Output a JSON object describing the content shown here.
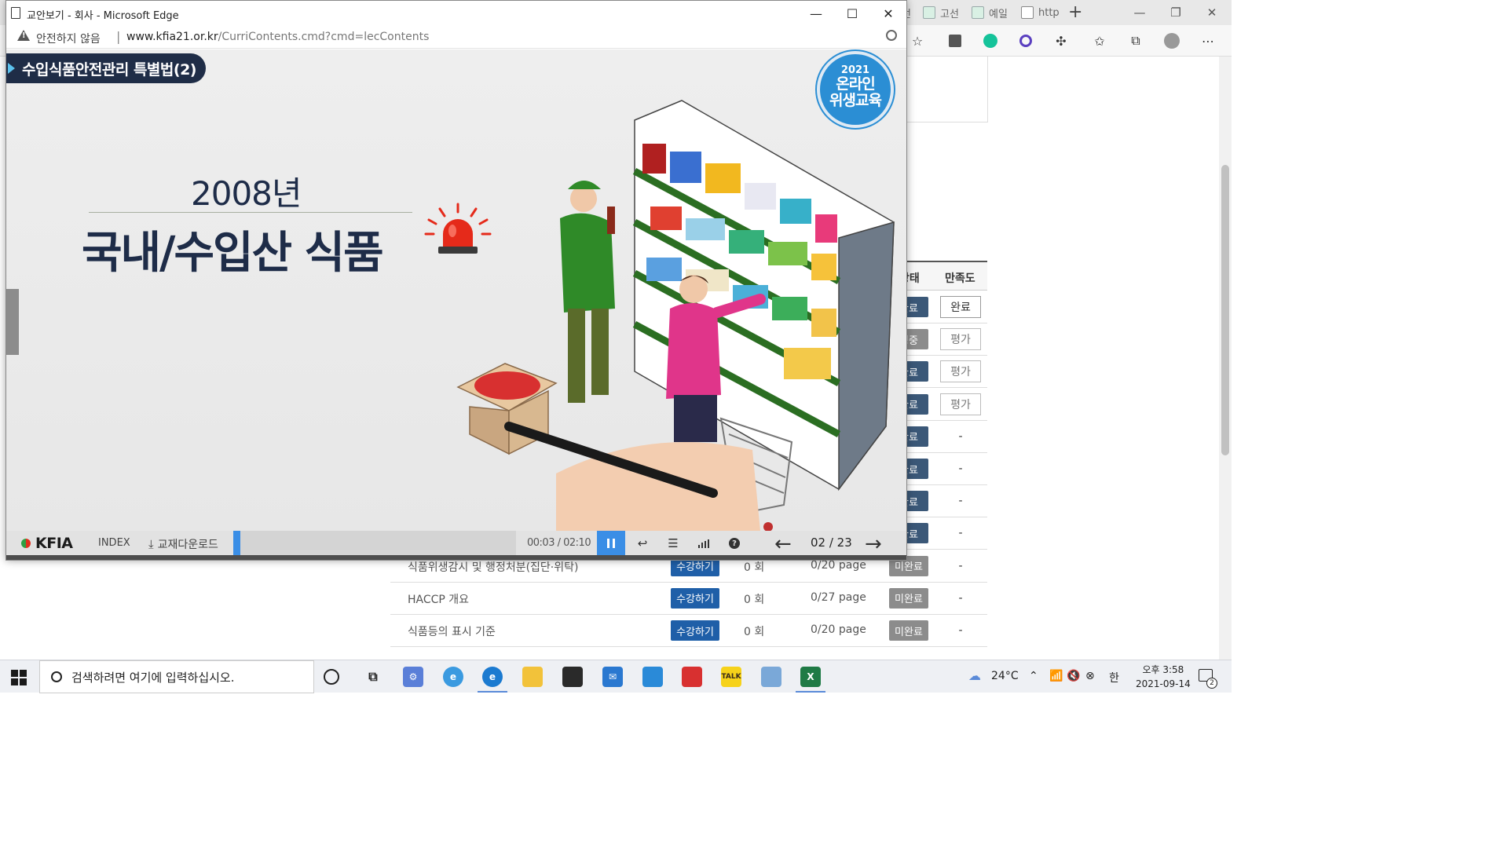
{
  "background_browser": {
    "tabs": [
      {
        "label": "선"
      },
      {
        "label": "고선"
      },
      {
        "label": "예일"
      },
      {
        "label": "http"
      }
    ],
    "new_tab_symbol": "+",
    "table": {
      "header_status": "상태",
      "header_satisfaction": "만족도",
      "rows": [
        {
          "title": "",
          "status": "완료",
          "satisfaction": "완료"
        },
        {
          "title": "",
          "status": "평중",
          "satisfaction": "평가"
        },
        {
          "title": "",
          "status": "완료",
          "satisfaction": "평가"
        },
        {
          "title": "",
          "status": "완료",
          "satisfaction": "평가"
        },
        {
          "title": "",
          "status": "완료",
          "satisfaction": "-"
        },
        {
          "title": "",
          "status": "완료",
          "satisfaction": "-"
        },
        {
          "title": "",
          "status": "완료",
          "satisfaction": "-"
        },
        {
          "title": "",
          "status": "완료",
          "satisfaction": "-"
        },
        {
          "title": "식품위생감시 및 행정처분(집단·위탁)",
          "button": "수강하기",
          "count": "0  회",
          "pages": "0/20 page",
          "status": "미완료",
          "satisfaction": "-"
        },
        {
          "title": "HACCP 개요",
          "button": "수강하기",
          "count": "0  회",
          "pages": "0/27 page",
          "status": "미완료",
          "satisfaction": "-"
        },
        {
          "title": "식품등의 표시 기준",
          "button": "수강하기",
          "count": "0  회",
          "pages": "0/20 page",
          "status": "미완료",
          "satisfaction": "-"
        }
      ]
    }
  },
  "popup": {
    "window_title": "교안보기 - 회사 - Microsoft Edge",
    "security_label": "안전하지 않음",
    "url_host": "www.kfia21.or.kr",
    "url_path": "/CurriContents.cmd?cmd=lecContents",
    "slide": {
      "lesson_title": "수입식품안전관리 특별법(2)",
      "badge_year": "2021",
      "badge_line1": "온라인",
      "badge_line2": "위생교육",
      "year_text": "2008년",
      "headline": "국내/수입산 식품"
    },
    "controls": {
      "logo_text": "KFIA",
      "index_label": "INDEX",
      "download_label": "교재다운로드",
      "progress": 0.024,
      "current_time": "00:03",
      "total_time": "02:10",
      "page_indicator": "02 / 23"
    }
  },
  "taskbar": {
    "search_placeholder": "검색하려면 여기에 입력하십시오.",
    "weather": "24°C",
    "ime": "한",
    "time": "오후 3:58",
    "date": "2021-09-14",
    "notification_count": "2"
  },
  "colors": {
    "accent_blue": "#3a8ee6",
    "navy": "#1e2c48",
    "course_button": "#1f5fa8",
    "status_incomplete": "#8c8c8c"
  }
}
